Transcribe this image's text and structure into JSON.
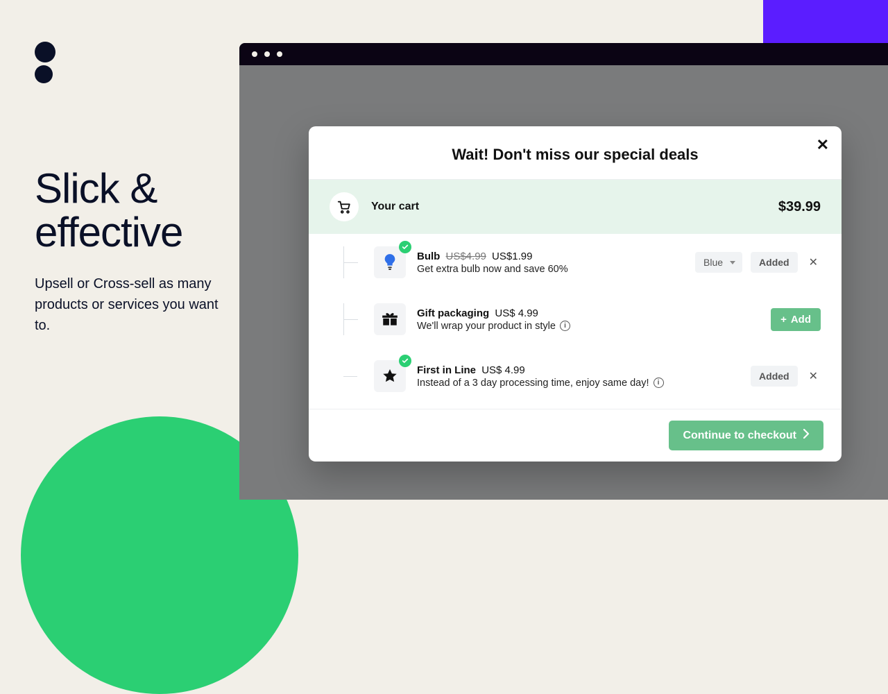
{
  "marketing": {
    "headline_line1": "Slick &",
    "headline_line2": "effective",
    "subhead": "Upsell or Cross-sell as many products or services you want to."
  },
  "modal": {
    "title": "Wait! Don't miss our special deals",
    "cart_label": "Your cart",
    "cart_total": "$39.99",
    "variant_selected": "Blue",
    "added_label": "Added",
    "add_label": "Add",
    "checkout_label": "Continue to checkout"
  },
  "deals": [
    {
      "name": "Bulb",
      "original_price": "US$4.99",
      "price": "US$1.99",
      "desc": "Get extra bulb now and save 60%",
      "added": true,
      "has_variant": true,
      "has_info": false
    },
    {
      "name": "Gift packaging",
      "original_price": "",
      "price": "US$ 4.99",
      "desc": "We'll wrap your product in style",
      "added": false,
      "has_variant": false,
      "has_info": true
    },
    {
      "name": "First in Line",
      "original_price": "",
      "price": "US$ 4.99",
      "desc": "Instead of a 3 day processing time, enjoy same day!",
      "added": true,
      "has_variant": false,
      "has_info": true
    }
  ]
}
